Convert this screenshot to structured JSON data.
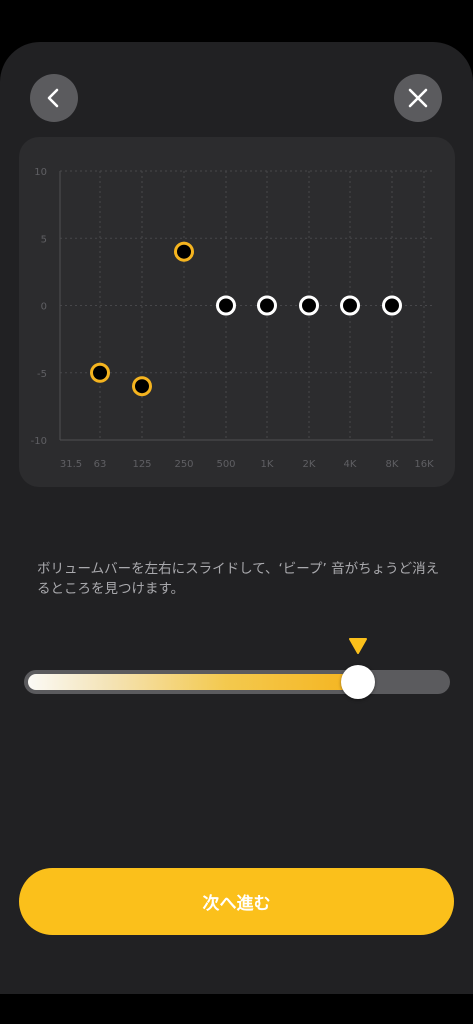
{
  "header": {
    "back_icon": "chevron-left-icon",
    "close_icon": "close-icon"
  },
  "chart_data": {
    "type": "scatter",
    "x_tick_labels": [
      "31.5",
      "63",
      "125",
      "250",
      "500",
      "1K",
      "2K",
      "4K",
      "8K",
      "16K"
    ],
    "y_tick_labels": [
      "10",
      "5",
      "0",
      "-5",
      "-10"
    ],
    "ylim": [
      -10,
      10
    ],
    "grid": true,
    "points": [
      {
        "x": "63",
        "y": -5,
        "status": "tested"
      },
      {
        "x": "125",
        "y": -6,
        "status": "tested"
      },
      {
        "x": "250",
        "y": 4,
        "status": "tested"
      },
      {
        "x": "500",
        "y": 0,
        "status": "pending"
      },
      {
        "x": "1K",
        "y": 0,
        "status": "pending"
      },
      {
        "x": "2K",
        "y": 0,
        "status": "pending"
      },
      {
        "x": "4K",
        "y": 0,
        "status": "pending"
      },
      {
        "x": "8K",
        "y": 0,
        "status": "pending"
      }
    ],
    "colors": {
      "tested": "#f5b41f",
      "pending": "#ffffff"
    }
  },
  "instruction": "ボリュームバーを左右にスライドして、‘ビープ’ 音がちょうど消えるところを見つけます。",
  "slider": {
    "value": 0.8
  },
  "next_button": {
    "label": "次へ進む"
  },
  "colors": {
    "accent": "#fbc01b",
    "background": "#212123",
    "card": "#2c2c2e"
  }
}
